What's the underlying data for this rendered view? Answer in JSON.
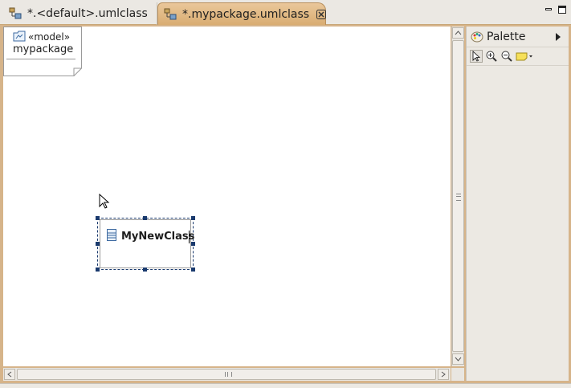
{
  "tabs": [
    {
      "label": "*.<default>.umlclass",
      "active": false,
      "icon": "uml-class-diagram-icon"
    },
    {
      "label": "*.mypackage.umlclass",
      "active": true,
      "icon": "uml-class-diagram-icon",
      "closable": true
    }
  ],
  "window_controls": {
    "minimize": "minimize-icon",
    "maximize": "maximize-icon"
  },
  "canvas": {
    "model_note": {
      "stereotype": "«model»",
      "name": "mypackage",
      "icon": "model-icon"
    },
    "class": {
      "name": "MyNewClass",
      "icon": "class-icon",
      "selected": true,
      "editing": true
    }
  },
  "palette": {
    "title": "Palette",
    "tools": [
      "select-tool-icon",
      "zoom-in-icon",
      "zoom-out-icon",
      "note-icon"
    ]
  },
  "colors": {
    "accent_tab": "#d9ad72",
    "frame": "#d6b48a",
    "selection": "#1a3a6e"
  }
}
